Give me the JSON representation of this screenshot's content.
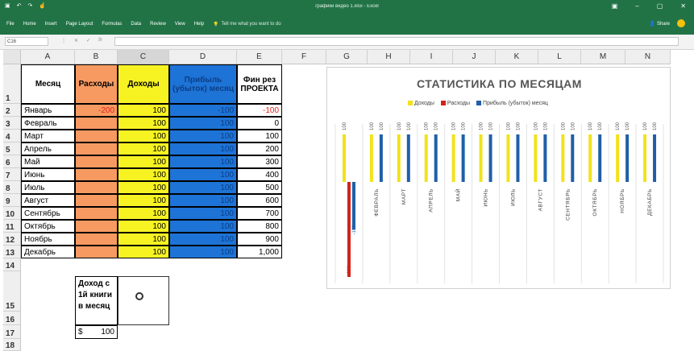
{
  "window": {
    "title": "графики видео 1.xlsx - Excel",
    "qa_icons": [
      "save-icon",
      "undo-icon",
      "redo-icon",
      "touch-icon"
    ],
    "controls": [
      "▣",
      "–",
      "▢",
      "✕"
    ]
  },
  "ribbon": {
    "tabs": [
      "File",
      "Home",
      "Insert",
      "Page Layout",
      "Formulas",
      "Data",
      "Review",
      "View",
      "Help"
    ],
    "tell_me": "Tell me what you want to do",
    "share": "Share"
  },
  "formula_bar": {
    "name_box": "C16",
    "fx": "fx",
    "value": ""
  },
  "columns": [
    "A",
    "B",
    "C",
    "D",
    "E",
    "F",
    "G",
    "H",
    "I",
    "J",
    "K",
    "L",
    "M",
    "N"
  ],
  "rows": [
    "1",
    "2",
    "3",
    "4",
    "5",
    "6",
    "7",
    "8",
    "9",
    "10",
    "11",
    "12",
    "13",
    "14",
    "15",
    "16",
    "17",
    "18"
  ],
  "table": {
    "headers": {
      "month": "Месяц",
      "expenses": "Расходы",
      "income": "Доходы",
      "profit": "Прибыль (убыток) месяц",
      "fin": "Фин рез ПРОЕКТА"
    },
    "rows": [
      {
        "month": "Январь",
        "expenses": "-200",
        "income": "100",
        "profit": "-100",
        "fin": "-100"
      },
      {
        "month": "Февраль",
        "expenses": "",
        "income": "100",
        "profit": "100",
        "fin": "0"
      },
      {
        "month": "Март",
        "expenses": "",
        "income": "100",
        "profit": "100",
        "fin": "100"
      },
      {
        "month": "Апрель",
        "expenses": "",
        "income": "100",
        "profit": "100",
        "fin": "200"
      },
      {
        "month": "Май",
        "expenses": "",
        "income": "100",
        "profit": "100",
        "fin": "300"
      },
      {
        "month": "Июнь",
        "expenses": "",
        "income": "100",
        "profit": "100",
        "fin": "400"
      },
      {
        "month": "Июль",
        "expenses": "",
        "income": "100",
        "profit": "100",
        "fin": "500"
      },
      {
        "month": "Август",
        "expenses": "",
        "income": "100",
        "profit": "100",
        "fin": "600"
      },
      {
        "month": "Сентябрь",
        "expenses": "",
        "income": "100",
        "profit": "100",
        "fin": "700"
      },
      {
        "month": "Октябрь",
        "expenses": "",
        "income": "100",
        "profit": "100",
        "fin": "800"
      },
      {
        "month": "Ноябрь",
        "expenses": "",
        "income": "100",
        "profit": "100",
        "fin": "900"
      },
      {
        "month": "Декабрь",
        "expenses": "",
        "income": "100",
        "profit": "100",
        "fin": "1,000"
      }
    ]
  },
  "extra": {
    "income_label": "Доход с 1й книги в месяц",
    "currency": "$",
    "income_value": "100"
  },
  "colors": {
    "orange": "#f79a62",
    "yellow": "#f7f323",
    "blue": "#1e73d6",
    "red_bar": "#d0241b",
    "blue_bar": "#1f5fa8"
  },
  "chart_data": {
    "type": "bar",
    "title": "СТАТИСТИКА ПО МЕСЯЦАМ",
    "categories": [
      "ЯНВАРЬ",
      "ФЕВРАЛЬ",
      "МАРТ",
      "АПРЕЛЬ",
      "МАЙ",
      "ИЮНЬ",
      "ИЮЛЬ",
      "АВГУСТ",
      "СЕНТЯБРЬ",
      "ОКТЯБРЬ",
      "НОЯБРЬ",
      "ДЕКАБРЬ"
    ],
    "series": [
      {
        "name": "Доходы",
        "color": "#f2e21b",
        "values": [
          100,
          100,
          100,
          100,
          100,
          100,
          100,
          100,
          100,
          100,
          100,
          100
        ]
      },
      {
        "name": "Расходы",
        "color": "#d0241b",
        "values": [
          -200,
          0,
          0,
          0,
          0,
          0,
          0,
          0,
          0,
          0,
          0,
          0
        ]
      },
      {
        "name": "Прибыль (убыток) месяц",
        "color": "#1f5fa8",
        "values": [
          -100,
          100,
          100,
          100,
          100,
          100,
          100,
          100,
          100,
          100,
          100,
          100
        ]
      }
    ],
    "ylim": [
      -200,
      100
    ],
    "legend": "top",
    "grid": true,
    "data_labels": true
  }
}
